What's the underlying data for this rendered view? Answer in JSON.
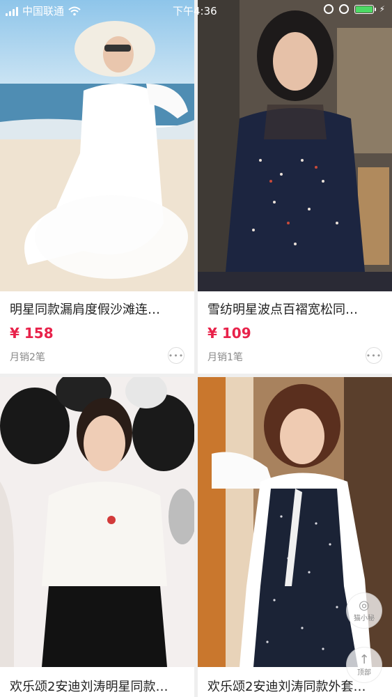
{
  "status_bar": {
    "carrier": "中国联通",
    "time": "下午4:36"
  },
  "products": [
    {
      "title": "明星同款漏肩度假沙滩连…",
      "price": "¥ 158",
      "sales": "月销2笔",
      "more_label": "•••",
      "image_desc": "woman in white dress and sun hat on beach"
    },
    {
      "title": "雪纺明星波点百褶宽松同…",
      "price": "¥ 109",
      "sales": "月销1笔",
      "more_label": "•••",
      "image_desc": "woman in navy polka dot pleated chiffon blouse"
    },
    {
      "title": "欢乐颂2安迪刘涛明星同款…",
      "image_desc": "woman in white lace blouse with black balloons"
    },
    {
      "title": "欢乐颂2安迪刘涛同款外套…",
      "image_desc": "woman in white shirt and navy polka dot vest"
    }
  ],
  "floating_buttons": {
    "assistant_label": "猫小秘",
    "top_label": "顶部"
  },
  "colors": {
    "price": "#e8224a",
    "background": "#efefef"
  }
}
